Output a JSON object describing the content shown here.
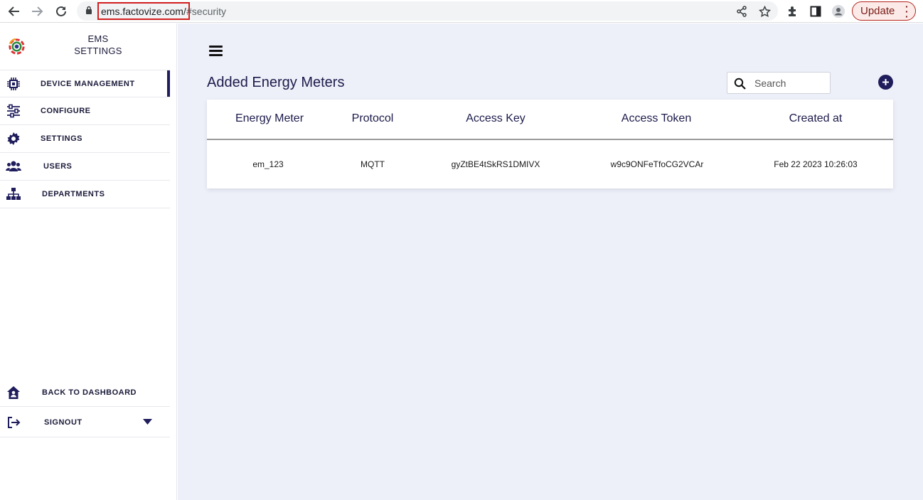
{
  "browser": {
    "url_domain": "ems.factovize.com/",
    "url_path": "#security",
    "update_label": "Update"
  },
  "sidebar": {
    "brand_line1": "EMS",
    "brand_line2": "SETTINGS",
    "items": [
      {
        "label": "DEVICE MANAGEMENT",
        "icon": "chip-icon",
        "active": true
      },
      {
        "label": "CONFIGURE",
        "icon": "sliders-icon"
      },
      {
        "label": "SETTINGS",
        "icon": "gear-icon"
      },
      {
        "label": "USERS",
        "icon": "users-icon"
      },
      {
        "label": "DEPARTMENTS",
        "icon": "org-chart-icon"
      }
    ],
    "bottom_items": [
      {
        "label": "BACK TO DASHBOARD",
        "icon": "home-user-icon"
      },
      {
        "label": "SIGNOUT",
        "icon": "signout-icon"
      }
    ]
  },
  "main": {
    "title": "Added Energy Meters",
    "search_placeholder": "Search",
    "table": {
      "columns": [
        "Energy Meter",
        "Protocol",
        "Access Key",
        "Access Token",
        "Created at"
      ],
      "rows": [
        [
          "em_123",
          "MQTT",
          "gyZtBE4tSkRS1DMIVX",
          "w9c9ONFeTfoCG2VCAr",
          "Feb 22 2023 10:26:03"
        ]
      ]
    }
  },
  "colors": {
    "accent": "#1f1d5c",
    "main_bg": "#eef0f9",
    "highlight_box": "#d42020"
  }
}
